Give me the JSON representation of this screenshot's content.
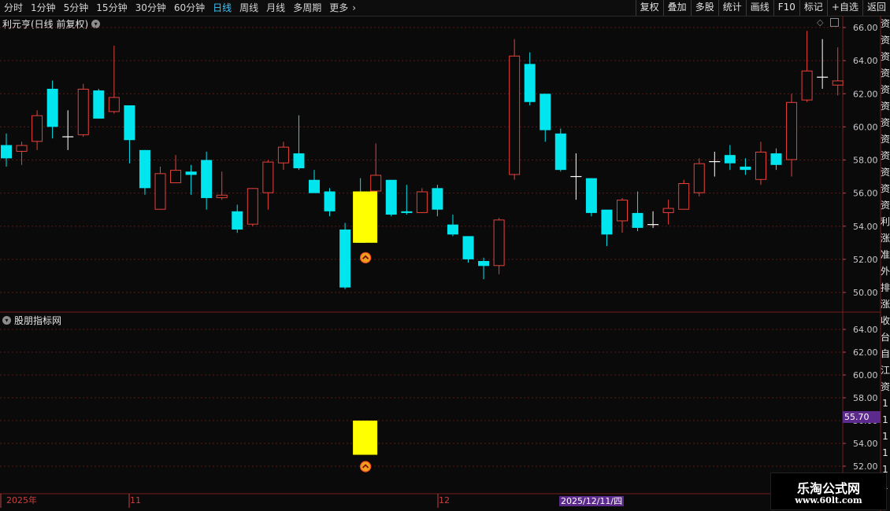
{
  "toolbar": {
    "periods": [
      "分时",
      "1分钟",
      "5分钟",
      "15分钟",
      "30分钟",
      "60分钟",
      "日线",
      "周线",
      "月线",
      "多周期",
      "更多"
    ],
    "active_period": "日线",
    "more_arrow": "›",
    "right_buttons": [
      "复权",
      "叠加",
      "多股",
      "统计",
      "画线",
      "F10",
      "标记",
      "+自选",
      "返回"
    ]
  },
  "main_chart": {
    "title": "利元亨(日线 前复权)",
    "dropdown_icon": "chevron-down-icon",
    "y_ticks": [
      "66.00",
      "64.00",
      "62.00",
      "60.00",
      "58.00",
      "56.00",
      "54.00",
      "52.00",
      "50.00"
    ],
    "up_color": "#e8413a",
    "down_color": "#00e5ee",
    "signal_color": "#ffff00",
    "signal_marker_icon": "double-chevron-up-icon"
  },
  "indicator_panel": {
    "title": "股朋指标网",
    "y_ticks": [
      "64.00",
      "62.00",
      "60.00",
      "58.00",
      "56.00",
      "54.00",
      "52.00"
    ],
    "current_value_tag": "55.70",
    "tag_color": "#5c2a8c"
  },
  "date_axis": {
    "labels": [
      "2025年",
      "11",
      "12"
    ],
    "cursor_date": "2025/12/11/四"
  },
  "right_side_panel": {
    "chars": [
      "资",
      "资",
      "资",
      "资",
      "资",
      "资",
      "资",
      "资",
      "资",
      "资",
      "资",
      "资",
      "利",
      "涨",
      "准",
      "外",
      "排",
      "涨",
      "收",
      "台",
      "自",
      "江",
      "资",
      "1",
      "1",
      "1",
      "1",
      "1",
      "1",
      "1"
    ]
  },
  "watermark": {
    "title": "乐淘公式网",
    "url": "www.60lt.com"
  },
  "chart_data": {
    "type": "candlestick",
    "ylim": [
      49.2,
      66.6
    ],
    "candles": [
      {
        "o": 58.9,
        "c": 58.1,
        "h": 59.6,
        "l": 57.6
      },
      {
        "o": 58.5,
        "c": 58.9,
        "h": 59.1,
        "l": 57.7
      },
      {
        "o": 59.1,
        "c": 60.7,
        "h": 61.0,
        "l": 58.6
      },
      {
        "o": 62.3,
        "c": 60.0,
        "h": 62.8,
        "l": 59.3
      },
      {
        "o": 59.4,
        "c": 59.4,
        "h": 61.0,
        "l": 58.6
      },
      {
        "o": 59.5,
        "c": 62.3,
        "h": 62.6,
        "l": 59.4
      },
      {
        "o": 62.2,
        "c": 60.5,
        "h": 62.3,
        "l": 60.5
      },
      {
        "o": 60.9,
        "c": 61.8,
        "h": 64.9,
        "l": 60.8
      },
      {
        "o": 61.3,
        "c": 59.2,
        "h": 61.3,
        "l": 57.8
      },
      {
        "o": 58.6,
        "c": 56.3,
        "h": 58.6,
        "l": 55.9
      },
      {
        "o": 55.0,
        "c": 57.2,
        "h": 57.6,
        "l": 55.0
      },
      {
        "o": 56.6,
        "c": 57.4,
        "h": 58.3,
        "l": 56.6
      },
      {
        "o": 57.3,
        "c": 57.1,
        "h": 57.7,
        "l": 55.9
      },
      {
        "o": 58.0,
        "c": 55.7,
        "h": 58.5,
        "l": 55.0
      },
      {
        "o": 55.7,
        "c": 55.9,
        "h": 57.3,
        "l": 55.6
      },
      {
        "o": 54.9,
        "c": 53.8,
        "h": 55.3,
        "l": 53.6
      },
      {
        "o": 54.1,
        "c": 56.3,
        "h": 56.3,
        "l": 54.0
      },
      {
        "o": 56.0,
        "c": 57.9,
        "h": 58.0,
        "l": 55.0
      },
      {
        "o": 57.8,
        "c": 58.8,
        "h": 59.1,
        "l": 57.4
      },
      {
        "o": 58.4,
        "c": 57.5,
        "h": 60.7,
        "l": 57.4
      },
      {
        "o": 56.8,
        "c": 56.0,
        "h": 57.4,
        "l": 56.0
      },
      {
        "o": 56.1,
        "c": 54.9,
        "h": 56.3,
        "l": 54.6
      },
      {
        "o": 53.8,
        "c": 50.3,
        "h": 54.2,
        "l": 50.2
      },
      {
        "o": 56.1,
        "c": 53.0,
        "h": 56.9,
        "l": 53.0
      },
      {
        "o": 56.1,
        "c": 57.1,
        "h": 59.0,
        "l": 55.8
      },
      {
        "o": 56.8,
        "c": 54.7,
        "h": 56.8,
        "l": 54.6
      },
      {
        "o": 54.9,
        "c": 54.8,
        "h": 56.5,
        "l": 54.7
      },
      {
        "o": 54.8,
        "c": 56.1,
        "h": 56.3,
        "l": 54.8
      },
      {
        "o": 56.3,
        "c": 55.0,
        "h": 56.5,
        "l": 54.6
      },
      {
        "o": 54.1,
        "c": 53.5,
        "h": 54.7,
        "l": 53.4
      },
      {
        "o": 53.4,
        "c": 52.0,
        "h": 53.4,
        "l": 51.8
      },
      {
        "o": 51.9,
        "c": 51.6,
        "h": 52.1,
        "l": 50.8
      },
      {
        "o": 51.6,
        "c": 54.4,
        "h": 54.5,
        "l": 51.1
      },
      {
        "o": 57.1,
        "c": 64.3,
        "h": 65.3,
        "l": 56.8
      },
      {
        "o": 63.8,
        "c": 61.5,
        "h": 64.5,
        "l": 61.3
      },
      {
        "o": 62.0,
        "c": 59.8,
        "h": 62.0,
        "l": 59.1
      },
      {
        "o": 59.6,
        "c": 57.4,
        "h": 59.9,
        "l": 57.3
      },
      {
        "o": 57.0,
        "c": 57.0,
        "h": 58.4,
        "l": 55.6
      },
      {
        "o": 56.9,
        "c": 54.8,
        "h": 56.9,
        "l": 54.6
      },
      {
        "o": 55.0,
        "c": 53.5,
        "h": 55.0,
        "l": 52.8
      },
      {
        "o": 54.3,
        "c": 55.6,
        "h": 55.7,
        "l": 53.6
      },
      {
        "o": 54.8,
        "c": 53.9,
        "h": 56.1,
        "l": 53.7
      },
      {
        "o": 54.1,
        "c": 54.1,
        "h": 54.9,
        "l": 53.9
      },
      {
        "o": 54.8,
        "c": 55.1,
        "h": 55.6,
        "l": 54.1
      },
      {
        "o": 55.0,
        "c": 56.6,
        "h": 56.8,
        "l": 55.0
      },
      {
        "o": 56.0,
        "c": 57.8,
        "h": 58.1,
        "l": 55.8
      },
      {
        "o": 57.9,
        "c": 57.9,
        "h": 58.5,
        "l": 57.0
      },
      {
        "o": 58.3,
        "c": 57.8,
        "h": 58.9,
        "l": 57.4
      },
      {
        "o": 57.6,
        "c": 57.4,
        "h": 58.1,
        "l": 57.1
      },
      {
        "o": 56.8,
        "c": 58.5,
        "h": 59.1,
        "l": 56.5
      },
      {
        "o": 58.4,
        "c": 57.7,
        "h": 58.7,
        "l": 57.4
      },
      {
        "o": 58.0,
        "c": 61.5,
        "h": 62.0,
        "l": 57.0
      },
      {
        "o": 61.6,
        "c": 63.4,
        "h": 65.8,
        "l": 61.5
      },
      {
        "o": 63.0,
        "c": 63.0,
        "h": 65.3,
        "l": 62.3
      },
      {
        "o": 62.5,
        "c": 62.8,
        "h": 64.8,
        "l": 61.9
      }
    ],
    "signal": {
      "index": 22,
      "top": 56.1,
      "bottom": 53.0
    }
  }
}
